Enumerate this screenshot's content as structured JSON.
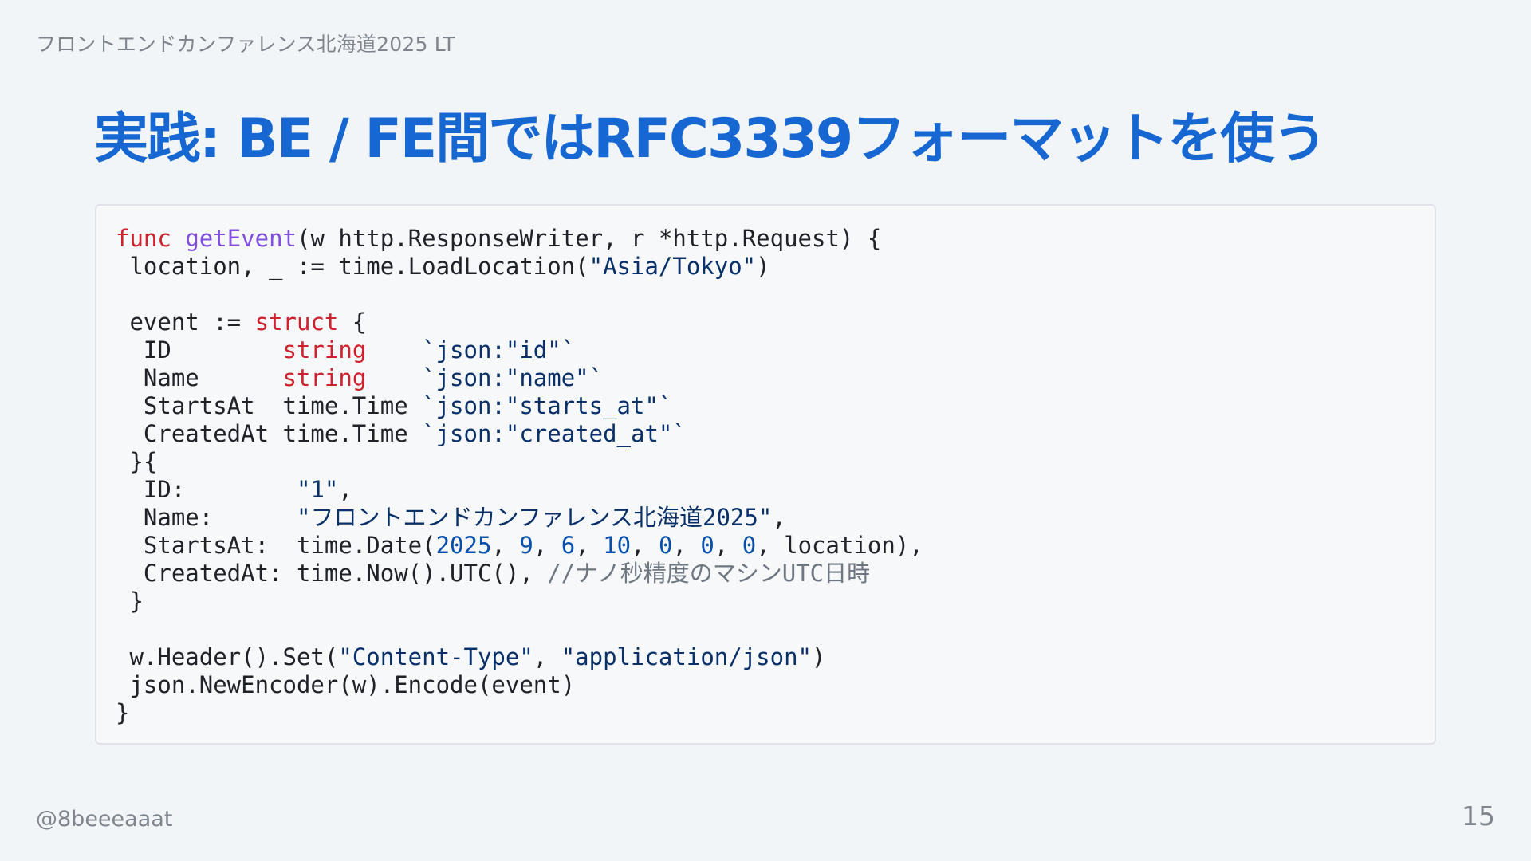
{
  "header": {
    "event_label": "フロントエンドカンファレンス北海道2025 LT"
  },
  "slide": {
    "title": "実践: BE / FE間ではRFC3339フォーマットを使う",
    "code_language": "go",
    "code_lines": [
      [
        [
          "kw",
          "func"
        ],
        [
          "plain",
          " "
        ],
        [
          "fn",
          "getEvent"
        ],
        [
          "plain",
          "(w http.ResponseWriter, r *http.Request) {"
        ]
      ],
      [
        [
          "plain",
          " location, _ := time.LoadLocation("
        ],
        [
          "str",
          "\"Asia/Tokyo\""
        ],
        [
          "plain",
          ")"
        ]
      ],
      [
        [
          "plain",
          ""
        ]
      ],
      [
        [
          "plain",
          " event := "
        ],
        [
          "kw",
          "struct"
        ],
        [
          "plain",
          " {"
        ]
      ],
      [
        [
          "plain",
          "  ID        "
        ],
        [
          "kw",
          "string"
        ],
        [
          "plain",
          "    "
        ],
        [
          "str",
          "`json:\"id\"`"
        ]
      ],
      [
        [
          "plain",
          "  Name      "
        ],
        [
          "kw",
          "string"
        ],
        [
          "plain",
          "    "
        ],
        [
          "str",
          "`json:\"name\"`"
        ]
      ],
      [
        [
          "plain",
          "  StartsAt  time.Time "
        ],
        [
          "str",
          "`json:\"starts_at\"`"
        ]
      ],
      [
        [
          "plain",
          "  CreatedAt time.Time "
        ],
        [
          "str",
          "`json:\"created_at\"`"
        ]
      ],
      [
        [
          "plain",
          " }{"
        ]
      ],
      [
        [
          "plain",
          "  ID:        "
        ],
        [
          "str",
          "\"1\""
        ],
        [
          "plain",
          ","
        ]
      ],
      [
        [
          "plain",
          "  Name:      "
        ],
        [
          "str",
          "\"フロントエンドカンファレンス北海道2025\""
        ],
        [
          "plain",
          ","
        ]
      ],
      [
        [
          "plain",
          "  StartsAt:  time.Date("
        ],
        [
          "num",
          "2025"
        ],
        [
          "plain",
          ", "
        ],
        [
          "num",
          "9"
        ],
        [
          "plain",
          ", "
        ],
        [
          "num",
          "6"
        ],
        [
          "plain",
          ", "
        ],
        [
          "num",
          "10"
        ],
        [
          "plain",
          ", "
        ],
        [
          "num",
          "0"
        ],
        [
          "plain",
          ", "
        ],
        [
          "num",
          "0"
        ],
        [
          "plain",
          ", "
        ],
        [
          "num",
          "0"
        ],
        [
          "plain",
          ", location),"
        ]
      ],
      [
        [
          "plain",
          "  CreatedAt: time.Now().UTC(), "
        ],
        [
          "cm",
          "//ナノ秒精度のマシンUTC日時"
        ]
      ],
      [
        [
          "plain",
          " }"
        ]
      ],
      [
        [
          "plain",
          ""
        ]
      ],
      [
        [
          "plain",
          " w.Header().Set("
        ],
        [
          "str",
          "\"Content-Type\""
        ],
        [
          "plain",
          ", "
        ],
        [
          "str",
          "\"application/json\""
        ],
        [
          "plain",
          ")"
        ]
      ],
      [
        [
          "plain",
          " json.NewEncoder(w).Encode(event)"
        ]
      ],
      [
        [
          "plain",
          "}"
        ]
      ]
    ]
  },
  "footer": {
    "author_handle": "@8beeeaaat",
    "page_number": "15"
  },
  "colors": {
    "background": "#f2f5f8",
    "title": "#1767d3",
    "muted_text": "#7e858d",
    "code_background": "#f6f8fa",
    "keyword": "#cf222e",
    "function_name": "#8250df",
    "string": "#0a3069",
    "number": "#0550ae",
    "comment": "#6e7781"
  }
}
